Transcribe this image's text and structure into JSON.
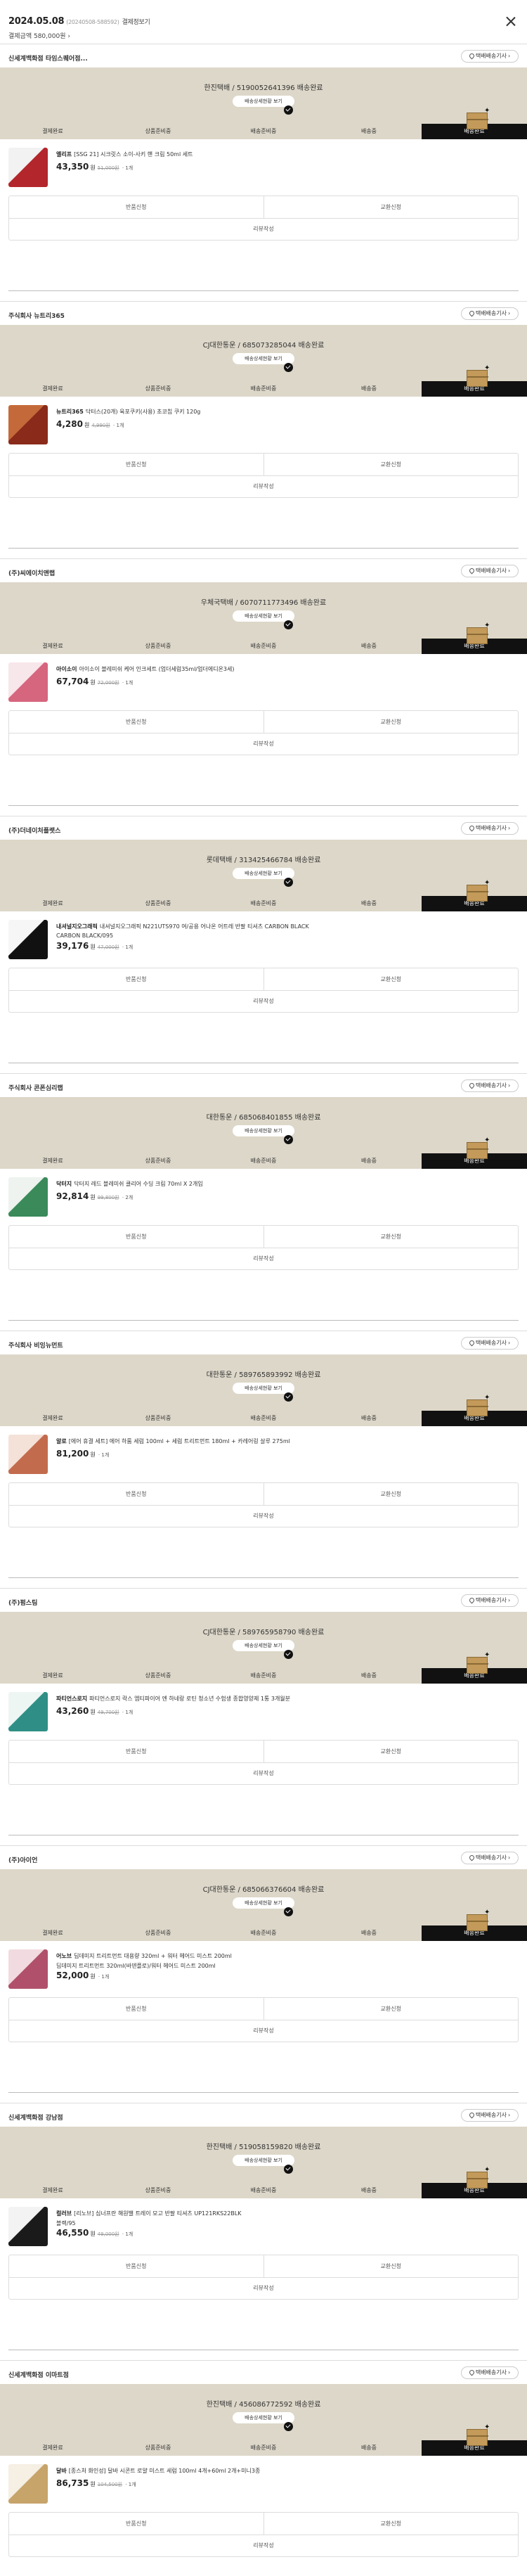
{
  "header": {
    "date": "2024.05.08",
    "order_no_prefix": "(",
    "order_no": "20240508-588592",
    "order_no_suffix": ")",
    "detail_link": "결제정보기",
    "total": "결제금액 580,000원"
  },
  "common": {
    "track_button": "배송상세현황 보기",
    "seller_button": "택배배송기사",
    "steps": [
      "결제완료",
      "상품준비중",
      "배송준비중",
      "배송중",
      "배송완료"
    ],
    "return_button": "반품신청",
    "exchange_button": "교환신청",
    "review_button": "리뷰작성"
  },
  "sellers": [
    {
      "name": "신세계백화점 타임스퀘어점...",
      "delivery": "한진택배 / 5190052641396 배송완료",
      "brand": "엘리프",
      "title": "[SSG 21] 시크릿스 소이-사키 핸 크림 50ml 세트",
      "subtitle": "",
      "price": "43,350",
      "orig": "51,000원",
      "qty": "1개",
      "thumb_colors": [
        "#f2f2f2",
        "#b3262c"
      ]
    },
    {
      "name": "주식회사 뉴트리365",
      "delivery": "CJ대한통운 / 685073285044 배송완료",
      "brand": "뉴트리365",
      "title": "닥터스(20개) 육포쿠키(사용) 초코칩 쿠키 120g",
      "subtitle": "",
      "price": "4,280",
      "orig": "4,990원",
      "qty": "1개",
      "thumb_colors": [
        "#c46a3a",
        "#8a2a1a"
      ]
    },
    {
      "name": "(주)씨에이치앤랩",
      "delivery": "우체국택배 / 6070711773496 배송완료",
      "brand": "아이소이",
      "title": "아이소이 블레미쉬 케어 인크세트 (업더세럼35ml/업더에디온3세)",
      "subtitle": "",
      "price": "67,704",
      "orig": "72,000원",
      "qty": "1개",
      "thumb_colors": [
        "#f7e6ea",
        "#d6657e"
      ]
    },
    {
      "name": "(주)더네이처플랫스",
      "delivery": "롯데택배 / 313425466784 배송완료",
      "brand": "내셔널지오그래픽",
      "title": "내셔널지오그래픽 N221UTS970 여/공용 어나온 어트레 반팔 티셔츠 CARBON BLACK",
      "subtitle": "CARBON BLACK/095",
      "price": "39,176",
      "orig": "47,000원",
      "qty": "1개",
      "thumb_colors": [
        "#f6f6f6",
        "#111111"
      ]
    },
    {
      "name": "주식회사 콘폰심리랩",
      "delivery": "대한통운 / 685068401855 배송완료",
      "brand": "닥터지",
      "title": "닥터지 레드 블레미쉬 클리어 수딩 크림 70ml X 2개입",
      "subtitle": "",
      "price": "92,814",
      "orig": "99,800원",
      "qty": "2개",
      "thumb_colors": [
        "#eef3ef",
        "#3a8a5a"
      ]
    },
    {
      "name": "주식회사 비잉뉴먼트",
      "delivery": "대한통운 / 589765893992 배송완료",
      "brand": "알로",
      "title": "[에어 휴결 세트] 에어 하룸 세럼 100ml + 세럼 트리트먼트 180ml + 카레어링 살루 275ml",
      "subtitle": "",
      "price": "81,200",
      "orig": "",
      "qty": "1개",
      "thumb_colors": [
        "#f4e1d8",
        "#c36b4d"
      ]
    },
    {
      "name": "(주)펌스팀",
      "delivery": "CJ대한통운 / 589765958790 배송완료",
      "brand": "파티언스로지",
      "title": "파티언스로지 락스 엠티파이어 엔 하네랑 로틴 청소년 수험생 종합영양제 1통 3개월분",
      "subtitle": "",
      "price": "43,260",
      "orig": "49,700원",
      "qty": "1개",
      "thumb_colors": [
        "#eef6f4",
        "#2f8f86"
      ]
    },
    {
      "name": "(주)아이언",
      "delivery": "CJ대한통운 / 685066376604 배송완료",
      "brand": "어노브",
      "title": "딥데미지 트리트먼트 대용량 320ml + 워터 헤어드 미스트 200ml",
      "subtitle": "딥데미지 트리트먼트 320ml(바덴플로)/워터 헤어드 미스트 200ml",
      "price": "52,000",
      "orig": "",
      "qty": "1개",
      "thumb_colors": [
        "#f1dbe0",
        "#b0506a"
      ]
    },
    {
      "name": "신세계백화점 강남점",
      "delivery": "한진택배 / 519058159820 배송완료",
      "brand": "컬러브",
      "title": "[리노브] 심너프란 해원밸 트레이 모고 반팔 티셔츠 UP121RKS22BLK",
      "subtitle": "블랙/95",
      "price": "46,550",
      "orig": "49,000원",
      "qty": "1개",
      "thumb_colors": [
        "#f3f3f3",
        "#1a1a1a"
      ]
    },
    {
      "name": "신세계백화점 이마트점",
      "delivery": "한진택배 / 456086772592 배송완료",
      "brand": "달바",
      "title": "[종스처 화인성] 달바 시콘트 로얄 미스트 세럼 100ml 4개+60ml 2개+미니3종",
      "subtitle": "",
      "price": "86,735",
      "orig": "104,500원",
      "qty": "1개",
      "thumb_colors": [
        "#f5efe4",
        "#c7a46a"
      ]
    }
  ]
}
